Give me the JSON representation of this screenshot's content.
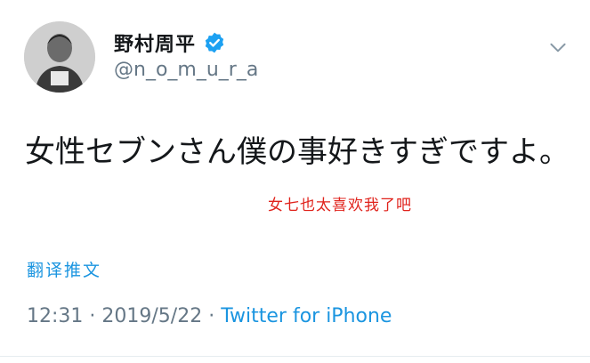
{
  "author": {
    "display_name": "野村周平",
    "handle": "@n_o_m_u_r_a",
    "verified": true
  },
  "tweet": {
    "text": "女性セブンさん僕の事好きすぎですよ。",
    "annotation": "女七也太喜欢我了吧",
    "translate_label": "翻译推文"
  },
  "meta": {
    "time": "12:31",
    "separator": "·",
    "date": "2019/5/22",
    "source": "Twitter for iPhone"
  },
  "icons": {
    "avatar": "profile-photo",
    "verified": "verified-badge-icon",
    "menu": "chevron-down-icon"
  },
  "colors": {
    "link": "#1b95e0",
    "muted": "#657786",
    "text": "#14171a",
    "annotation": "#e0231c"
  }
}
